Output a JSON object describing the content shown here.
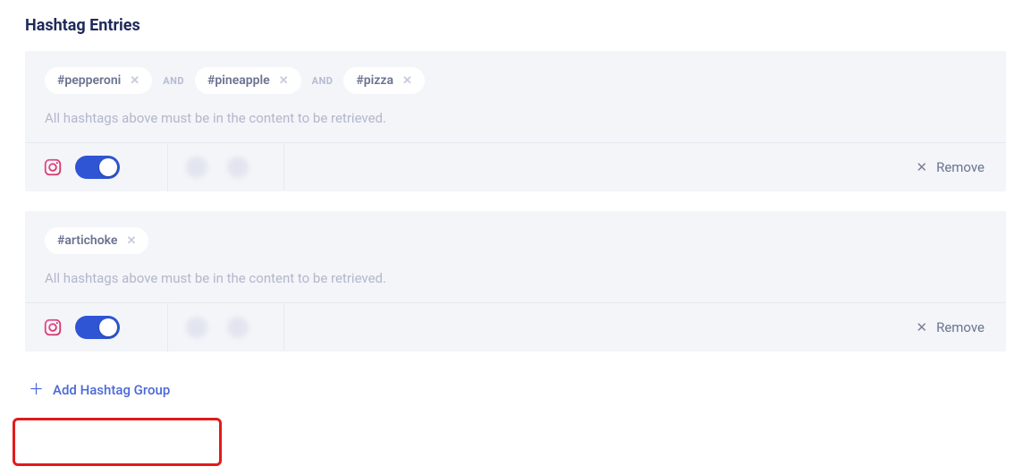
{
  "section_title": "Hashtag Entries",
  "hint_text": "All hashtags above must be in the content to be retrieved.",
  "operators": {
    "and": "AND"
  },
  "remove_label": "Remove",
  "add_group_label": "Add Hashtag Group",
  "groups": [
    {
      "tags": [
        "#pepperoni",
        "#pineapple",
        "#pizza"
      ],
      "toggle_on": true
    },
    {
      "tags": [
        "#artichoke"
      ],
      "toggle_on": true
    }
  ]
}
